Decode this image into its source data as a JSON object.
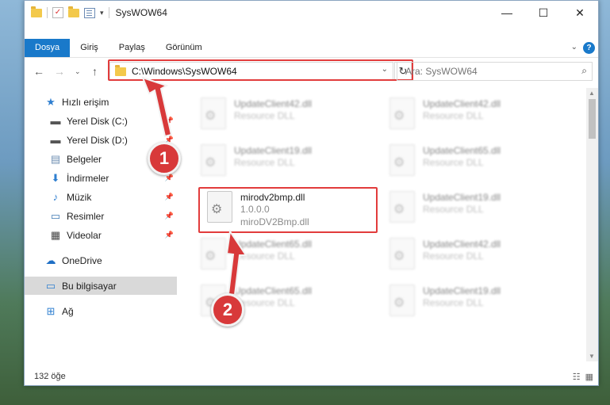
{
  "window": {
    "title": "SysWOW64",
    "controls": {
      "minimize": "—",
      "maximize": "☐",
      "close": "✕"
    }
  },
  "ribbon": {
    "tabs": [
      {
        "label": "Dosya",
        "active": true
      },
      {
        "label": "Giriş"
      },
      {
        "label": "Paylaş"
      },
      {
        "label": "Görünüm"
      }
    ],
    "help": "?"
  },
  "addressbar": {
    "path": "C:\\Windows\\SysWOW64",
    "search_placeholder": "Ara: SysWOW64"
  },
  "navpane": {
    "items": [
      {
        "label": "Hızlı erişim",
        "icon": "star-icon"
      },
      {
        "label": "Yerel Disk (C:)",
        "icon": "drive-icon",
        "pinned": true
      },
      {
        "label": "Yerel Disk (D:)",
        "icon": "drive-icon",
        "pinned": true
      },
      {
        "label": "Belgeler",
        "icon": "documents-icon",
        "pinned": true
      },
      {
        "label": "İndirmeler",
        "icon": "download-icon",
        "pinned": true
      },
      {
        "label": "Müzik",
        "icon": "music-icon",
        "pinned": true
      },
      {
        "label": "Resimler",
        "icon": "pictures-icon",
        "pinned": true
      },
      {
        "label": "Videolar",
        "icon": "videos-icon",
        "pinned": true
      },
      {
        "label": "OneDrive",
        "icon": "cloud-icon"
      },
      {
        "label": "Bu bilgisayar",
        "icon": "computer-icon",
        "selected": true
      },
      {
        "label": "Ağ",
        "icon": "network-icon"
      }
    ]
  },
  "files": [
    {
      "name": "UpdateClient42.dll",
      "line2": "Resource DLL",
      "line3": ""
    },
    {
      "name": "UpdateClient42.dll",
      "line2": "Resource DLL",
      "line3": ""
    },
    {
      "name": "UpdateClient19.dll",
      "line2": "Resource DLL",
      "line3": ""
    },
    {
      "name": "UpdateClient65.dll",
      "line2": "Resource DLL",
      "line3": ""
    },
    {
      "name": "mirodv2bmp.dll",
      "line2": "1.0.0.0",
      "line3": "miroDV2Bmp.dll",
      "highlighted": true
    },
    {
      "name": "UpdateClient19.dll",
      "line2": "Resource DLL",
      "line3": ""
    },
    {
      "name": "UpdateClient65.dll",
      "line2": "Resource DLL",
      "line3": ""
    },
    {
      "name": "UpdateClient42.dll",
      "line2": "Resource DLL",
      "line3": ""
    },
    {
      "name": "UpdateClient65.dll",
      "line2": "Resource DLL",
      "line3": ""
    },
    {
      "name": "UpdateClient19.dll",
      "line2": "Resource DLL",
      "line3": ""
    }
  ],
  "status": {
    "count": "132 öğe"
  },
  "annotations": {
    "step1": "1",
    "step2": "2",
    "color": "#d8393a"
  }
}
